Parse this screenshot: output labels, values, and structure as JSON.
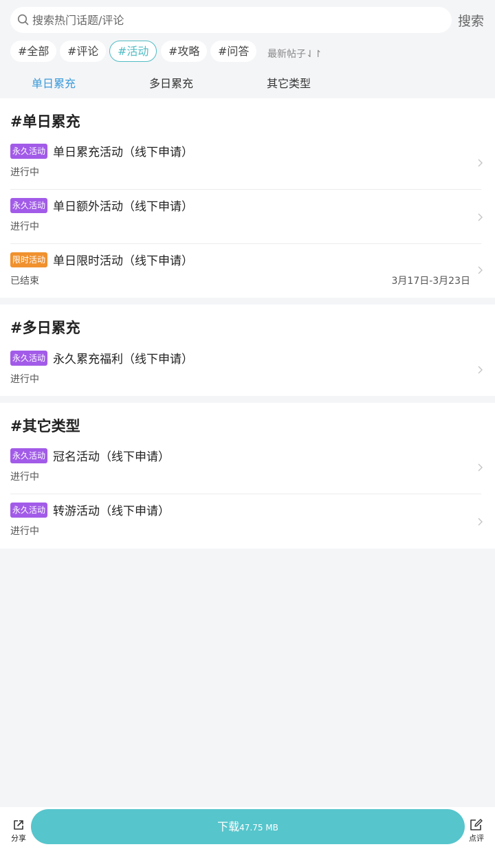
{
  "search": {
    "placeholder": "搜索热门话题/评论",
    "button_label": "搜索"
  },
  "filters": {
    "chips": [
      {
        "label": "#全部"
      },
      {
        "label": "#评论"
      },
      {
        "label": "#活动",
        "active": true
      },
      {
        "label": "#攻略"
      },
      {
        "label": "#问答"
      }
    ],
    "sort_label": "最新帖子⇃↾"
  },
  "tabs": [
    {
      "label": "单日累充",
      "active": true
    },
    {
      "label": "多日累充"
    },
    {
      "label": "其它类型"
    }
  ],
  "sections": [
    {
      "title": "#单日累充",
      "items": [
        {
          "tag": "永久活动",
          "tag_type": "permanent",
          "title": "单日累充活动（线下申请）",
          "status": "进行中"
        },
        {
          "tag": "永久活动",
          "tag_type": "permanent",
          "title": "单日额外活动（线下申请）",
          "status": "进行中"
        },
        {
          "tag": "限时活动",
          "tag_type": "limited",
          "title": "单日限时活动（线下申请）",
          "status": "已结束",
          "date": "3月17日-3月23日"
        }
      ]
    },
    {
      "title": "#多日累充",
      "items": [
        {
          "tag": "永久活动",
          "tag_type": "permanent",
          "title": "永久累充福利（线下申请）",
          "status": "进行中"
        }
      ]
    },
    {
      "title": "#其它类型",
      "items": [
        {
          "tag": "永久活动",
          "tag_type": "permanent",
          "title": "冠名活动（线下申请）",
          "status": "进行中"
        },
        {
          "tag": "永久活动",
          "tag_type": "permanent",
          "title": "转游活动（线下申请）",
          "status": "进行中"
        }
      ]
    }
  ],
  "bottom_bar": {
    "share_label": "分享",
    "download_label": "下载",
    "download_size": "47.75 MB",
    "review_label": "点评"
  },
  "colors": {
    "accent": "#4fbcc4",
    "tab_active": "#3a9ad9",
    "tag_permanent": "#a25be8",
    "tag_limited": "#f0912e",
    "download_button": "#56c5cc"
  },
  "icons": [
    "search-icon",
    "chevron-right-icon",
    "share-icon",
    "edit-icon"
  ]
}
